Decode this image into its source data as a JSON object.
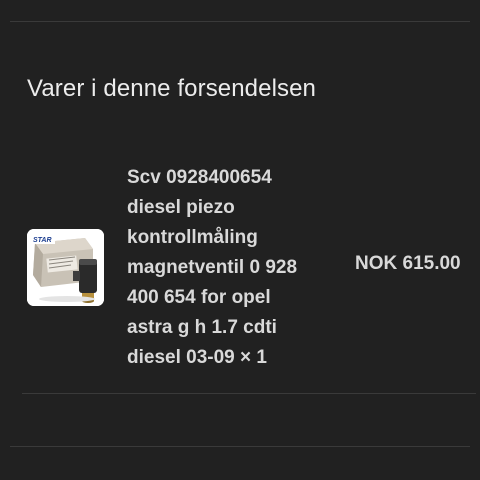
{
  "section": {
    "title": "Varer i denne forsendelsen"
  },
  "item": {
    "name": "Scv 0928400654\ndiesel piezo\nkontrollmåling\nmagnetventil 0 928\n400 654 for opel\nastra g h 1.7 cdti\ndiesel 03-09 × 1",
    "price": "NOK 615.00",
    "thumbnail_logo_text": "STAR",
    "thumbnail_icon": "product-photo"
  }
}
